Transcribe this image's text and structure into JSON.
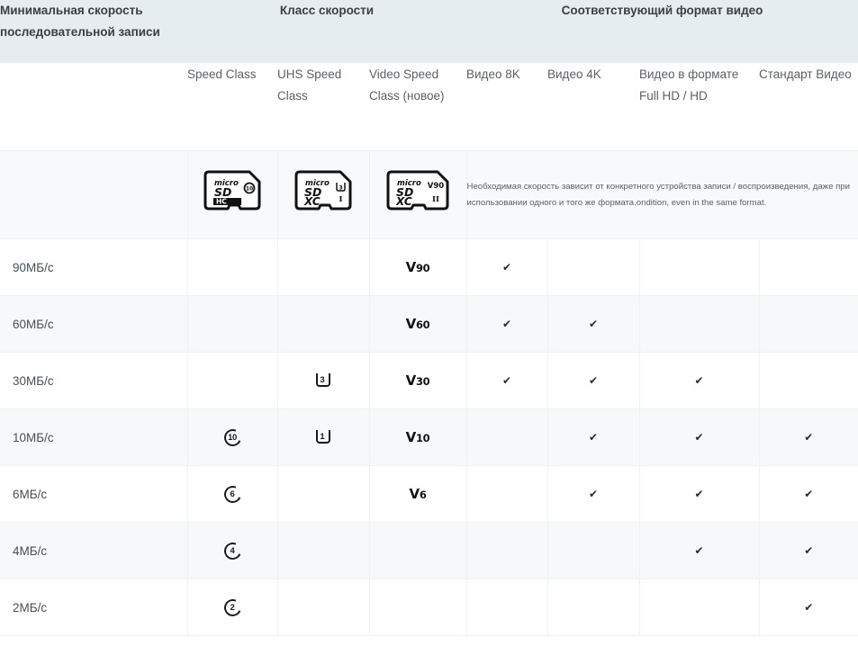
{
  "table": {
    "group_headers": [
      {
        "label": "Минимальная скорость последовательной записи",
        "align": "left"
      },
      {
        "label": "Класс скорости",
        "align": "center"
      },
      {
        "label": "Соответствующий формат видео",
        "align": "center"
      }
    ],
    "column_headers": [
      "",
      "Speed Class",
      "UHS Speed Class",
      "Video Speed Class (новое)",
      "Видео 8K",
      "Видео 4K",
      "Видео в формате Full HD / HD",
      "Стандарт Видео"
    ],
    "card_row": {
      "cards": [
        {
          "name": "microsd-sdhc-class10-card",
          "top": "micro",
          "mid": "SD",
          "bottom": "HC",
          "mark": "10",
          "mark_type": "circle",
          "roman": ""
        },
        {
          "name": "microsd-sdxc-u3-card",
          "top": "micro",
          "mid": "SD",
          "bottom": "XC",
          "mark": "3",
          "mark_type": "u",
          "roman": "I"
        },
        {
          "name": "microsd-sdxc-v90-card",
          "top": "micro",
          "mid": "SD",
          "bottom": "XC",
          "mark": "V90",
          "mark_type": "text",
          "roman": "II"
        }
      ],
      "note": "Необходимая скорость зависит от конкретного устройства записи / воспроизведения, даже при использовании одного и того же формата.ondition, even in the same format."
    },
    "rows": [
      {
        "speed": "90МБ/с",
        "speed_class": "",
        "uhs_class": "",
        "video_speed_class": "V90",
        "video_8k": "✔",
        "video_4k": "",
        "video_fullhd": "",
        "video_standard": ""
      },
      {
        "speed": "60МБ/с",
        "speed_class": "",
        "uhs_class": "",
        "video_speed_class": "V60",
        "video_8k": "✔",
        "video_4k": "✔",
        "video_fullhd": "",
        "video_standard": ""
      },
      {
        "speed": "30МБ/с",
        "speed_class": "",
        "uhs_class": "3",
        "video_speed_class": "V30",
        "video_8k": "✔",
        "video_4k": "✔",
        "video_fullhd": "✔",
        "video_standard": ""
      },
      {
        "speed": "10МБ/с",
        "speed_class": "10",
        "uhs_class": "1",
        "video_speed_class": "V10",
        "video_8k": "",
        "video_4k": "✔",
        "video_fullhd": "✔",
        "video_standard": "✔"
      },
      {
        "speed": "6МБ/с",
        "speed_class": "6",
        "uhs_class": "",
        "video_speed_class": "V6",
        "video_8k": "",
        "video_4k": "✔",
        "video_fullhd": "✔",
        "video_standard": "✔"
      },
      {
        "speed": "4МБ/с",
        "speed_class": "4",
        "uhs_class": "",
        "video_speed_class": "",
        "video_8k": "",
        "video_4k": "",
        "video_fullhd": "✔",
        "video_standard": "✔"
      },
      {
        "speed": "2МБ/с",
        "speed_class": "2",
        "uhs_class": "",
        "video_speed_class": "",
        "video_8k": "",
        "video_4k": "",
        "video_fullhd": "",
        "video_standard": "✔"
      }
    ]
  },
  "colors": {
    "header_bg": "#e6edf0",
    "row_alt_bg": "#f7f8f9",
    "card_row_bg": "#f8f9fa",
    "text": "#3c4043",
    "border": "#f0f1f2"
  }
}
